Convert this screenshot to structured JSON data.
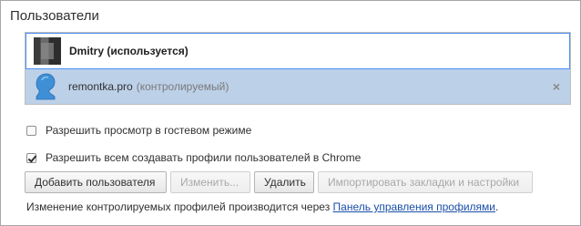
{
  "section": {
    "title": "Пользователи"
  },
  "users": [
    {
      "name": "Dmitry (используется)",
      "avatar": "pixelated-photo-avatar"
    },
    {
      "name": "remontka.pro",
      "status": "(контролируемый)",
      "avatar": "blue-silhouette-avatar",
      "remove_icon": "×"
    }
  ],
  "options": {
    "guest_browsing": {
      "label": "Разрешить просмотр в гостевом режиме",
      "checked": false
    },
    "allow_profiles": {
      "label": "Разрешить всем создавать профили пользователей в Chrome",
      "checked": true
    }
  },
  "buttons": {
    "add": "Добавить пользователя",
    "edit": "Изменить...",
    "delete": "Удалить",
    "import": "Импортировать закладки и настройки"
  },
  "footer": {
    "text": "Изменение контролируемых профилей производится через ",
    "link": "Панель управления профилями",
    "end": "."
  },
  "colors": {
    "selected_row": "#bcd0e8",
    "focus_border": "#4d90fe",
    "link": "#1a4ea8",
    "avatar_blue": "#3f8fd6"
  }
}
